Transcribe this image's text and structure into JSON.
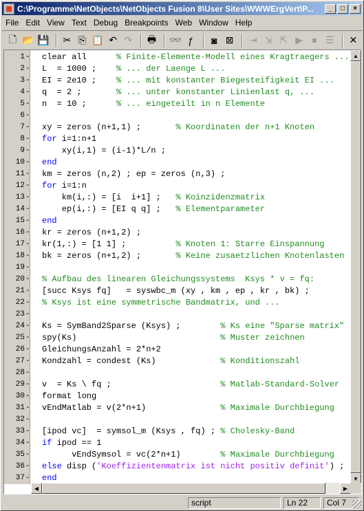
{
  "window": {
    "title": "C:\\Programme\\NetObjects\\NetObjects Fusion 8\\User Sites\\WWWErgVert\\P...",
    "minimize": "_",
    "maximize": "□",
    "close": "×"
  },
  "menu": [
    {
      "label": "File"
    },
    {
      "label": "Edit"
    },
    {
      "label": "View"
    },
    {
      "label": "Text"
    },
    {
      "label": "Debug"
    },
    {
      "label": "Breakpoints"
    },
    {
      "label": "Web"
    },
    {
      "label": "Window"
    },
    {
      "label": "Help"
    }
  ],
  "toolbar": [
    {
      "icon": "new-file-icon",
      "glyph": "🗋",
      "enabled": true
    },
    {
      "icon": "open-folder-icon",
      "glyph": "📂",
      "enabled": true
    },
    {
      "icon": "save-icon",
      "glyph": "💾",
      "enabled": true
    },
    {
      "icon": "cut-icon",
      "glyph": "✂",
      "enabled": true
    },
    {
      "icon": "copy-icon",
      "glyph": "⎘",
      "enabled": true
    },
    {
      "icon": "paste-icon",
      "glyph": "📋",
      "enabled": true
    },
    {
      "icon": "undo-icon",
      "glyph": "↶",
      "enabled": true
    },
    {
      "icon": "redo-icon",
      "glyph": "↷",
      "enabled": false
    },
    {
      "icon": "print-icon",
      "glyph": "🖶",
      "enabled": true
    },
    {
      "icon": "find-icon",
      "glyph": "👓",
      "enabled": true
    },
    {
      "icon": "function-icon",
      "glyph": "ƒ",
      "enabled": true
    },
    {
      "icon": "set-breakpoint-icon",
      "glyph": "◙",
      "enabled": true
    },
    {
      "icon": "clear-breakpoints-icon",
      "glyph": "⊠",
      "enabled": true
    },
    {
      "icon": "step-icon",
      "glyph": "⇥",
      "enabled": false
    },
    {
      "icon": "step-in-icon",
      "glyph": "⇲",
      "enabled": false
    },
    {
      "icon": "step-out-icon",
      "glyph": "⇱",
      "enabled": false
    },
    {
      "icon": "continue-icon",
      "glyph": "▶",
      "enabled": false
    },
    {
      "icon": "exit-debug-icon",
      "glyph": "⏹",
      "enabled": false
    },
    {
      "icon": "stack-icon",
      "glyph": "☰",
      "enabled": false
    },
    {
      "icon": "close-doc-icon",
      "glyph": "✕",
      "enabled": true
    }
  ],
  "code_lines": [
    [
      {
        "t": "tx",
        "s": "clear all      "
      },
      {
        "t": "cm",
        "s": "% Finite-Elemente-Modell eines Kragtraegers ..."
      }
    ],
    [
      {
        "t": "tx",
        "s": "L  = 1000 ;    "
      },
      {
        "t": "cm",
        "s": "% ... der Laenge L ..."
      }
    ],
    [
      {
        "t": "tx",
        "s": "EI = 2e10 ;    "
      },
      {
        "t": "cm",
        "s": "% ... mit konstanter Biegesteifigkeit EI ..."
      }
    ],
    [
      {
        "t": "tx",
        "s": "q  = 2 ;       "
      },
      {
        "t": "cm",
        "s": "% ... unter konstanter Linienlast q, ..."
      }
    ],
    [
      {
        "t": "tx",
        "s": "n  = 10 ;      "
      },
      {
        "t": "cm",
        "s": "% ... eingeteilt in n Elemente"
      }
    ],
    [],
    [
      {
        "t": "tx",
        "s": "xy = zeros (n+1,1) ;       "
      },
      {
        "t": "cm",
        "s": "% Koordinaten der n+1 Knoten"
      }
    ],
    [
      {
        "t": "kw",
        "s": "for"
      },
      {
        "t": "tx",
        "s": " i=1:n+1"
      }
    ],
    [
      {
        "t": "tx",
        "s": "    xy(i,1) = (i-1)*L/n ;"
      }
    ],
    [
      {
        "t": "kw",
        "s": "end"
      }
    ],
    [
      {
        "t": "tx",
        "s": "km = zeros (n,2) ; ep = zeros (n,3) ;"
      }
    ],
    [
      {
        "t": "kw",
        "s": "for"
      },
      {
        "t": "tx",
        "s": " i=1:n"
      }
    ],
    [
      {
        "t": "tx",
        "s": "    km(i,:) = [i  i+1] ;   "
      },
      {
        "t": "cm",
        "s": "% Koinzidenzmatrix"
      }
    ],
    [
      {
        "t": "tx",
        "s": "    ep(i,:) = [EI q q] ;   "
      },
      {
        "t": "cm",
        "s": "% Elementparameter"
      }
    ],
    [
      {
        "t": "kw",
        "s": "end"
      }
    ],
    [
      {
        "t": "tx",
        "s": "kr = zeros (n+1,2) ;"
      }
    ],
    [
      {
        "t": "tx",
        "s": "kr(1,:) = [1 1] ;          "
      },
      {
        "t": "cm",
        "s": "% Knoten 1: Starre Einspannung"
      }
    ],
    [
      {
        "t": "tx",
        "s": "bk = zeros (n+1,2) ;       "
      },
      {
        "t": "cm",
        "s": "% Keine zusaetzlichen Knotenlasten"
      }
    ],
    [],
    [
      {
        "t": "cm",
        "s": "% Aufbau des linearen Gleichungssystems  Ksys * v = fq:"
      }
    ],
    [
      {
        "t": "tx",
        "s": "[succ Ksys fq]   = syswbc_m (xy , km , ep , kr , bk) ;"
      }
    ],
    [
      {
        "t": "cm",
        "s": "% Ksys ist eine symmetrische Bandmatrix, und ..."
      }
    ],
    [],
    [
      {
        "t": "tx",
        "s": "Ks = SymBand2Sparse (Ksys) ;        "
      },
      {
        "t": "cm",
        "s": "% Ks eine \"Sparse matrix\""
      }
    ],
    [
      {
        "t": "tx",
        "s": "spy(Ks)                             "
      },
      {
        "t": "cm",
        "s": "% Muster zeichnen"
      }
    ],
    [
      {
        "t": "tx",
        "s": "GleichungsAnzahl = 2*n+2"
      }
    ],
    [
      {
        "t": "tx",
        "s": "Kondzahl = condest (Ks)             "
      },
      {
        "t": "cm",
        "s": "% Konditionszahl"
      }
    ],
    [],
    [
      {
        "t": "tx",
        "s": "v  = Ks \\ fq ;                      "
      },
      {
        "t": "cm",
        "s": "% Matlab-Standard-Solver"
      }
    ],
    [
      {
        "t": "tx",
        "s": "format long"
      }
    ],
    [
      {
        "t": "tx",
        "s": "vEndMatlab = v(2*n+1)               "
      },
      {
        "t": "cm",
        "s": "% Maximale Durchbiegung"
      }
    ],
    [],
    [
      {
        "t": "tx",
        "s": "[ipod vc]  = symsol_m (Ksys , fq) ; "
      },
      {
        "t": "cm",
        "s": "% Cholesky-Band"
      }
    ],
    [
      {
        "t": "kw",
        "s": "if"
      },
      {
        "t": "tx",
        "s": " ipod == 1"
      }
    ],
    [
      {
        "t": "tx",
        "s": "      vEndSymsol = vc(2*n+1)        "
      },
      {
        "t": "cm",
        "s": "% Maximale Durchbiegung"
      }
    ],
    [
      {
        "t": "kw",
        "s": "else"
      },
      {
        "t": "tx",
        "s": " disp ("
      },
      {
        "t": "st",
        "s": "'Koeffizientenmatrix ist nicht positiv definit'"
      },
      {
        "t": "tx",
        "s": ") ;"
      }
    ],
    [
      {
        "t": "kw",
        "s": "end"
      }
    ]
  ],
  "status": {
    "mode": "script",
    "line": "Ln 22",
    "col": "Col 7"
  }
}
